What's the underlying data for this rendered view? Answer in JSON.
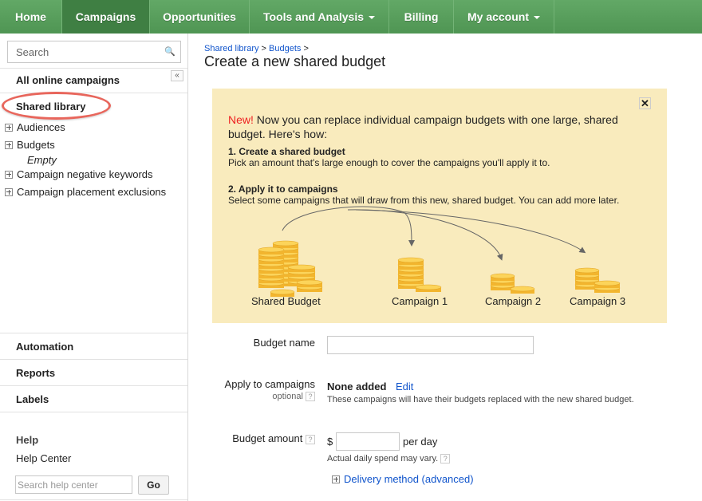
{
  "nav": {
    "tabs": [
      {
        "label": "Home"
      },
      {
        "label": "Campaigns"
      },
      {
        "label": "Opportunities"
      },
      {
        "label": "Tools and Analysis"
      },
      {
        "label": "Billing"
      },
      {
        "label": "My account"
      }
    ]
  },
  "sidebar": {
    "search_placeholder": "Search",
    "all_campaigns": "All online campaigns",
    "collapse": "«",
    "shared_library": "Shared library",
    "tree": [
      {
        "label": "Audiences"
      },
      {
        "label": "Budgets"
      },
      {
        "label": "Campaign negative keywords"
      },
      {
        "label": "Campaign placement exclusions"
      }
    ],
    "budgets_empty": "Empty",
    "automation": "Automation",
    "reports": "Reports",
    "labels": "Labels",
    "help": "Help",
    "help_center": "Help Center",
    "help_search_placeholder": "Search help center",
    "go": "Go"
  },
  "breadcrumb": {
    "shared_library": "Shared library",
    "budgets": "Budgets",
    "sep": ">"
  },
  "page_title": "Create a new shared budget",
  "promo": {
    "new": "New!",
    "intro": "Now you can replace individual campaign budgets with one large, shared budget. Here's how:",
    "close": "✕",
    "step1_title": "1. Create a shared budget",
    "step1_text": "Pick an amount that's large enough to cover the campaigns you'll apply it to.",
    "step2_title": "2. Apply it to campaigns",
    "step2_text": "Select some campaigns that will draw from this new, shared budget. You can add more later.",
    "labels": [
      "Shared Budget",
      "Campaign 1",
      "Campaign 2",
      "Campaign 3"
    ]
  },
  "form": {
    "budget_name_label": "Budget name",
    "budget_name_value": "",
    "apply_label": "Apply to campaigns",
    "optional": "optional",
    "none_added": "None added",
    "edit": "Edit",
    "apply_help": "These campaigns will have their budgets replaced with the new shared budget.",
    "amount_label": "Budget amount",
    "currency": "$",
    "amount_value": "",
    "per_day": "per day",
    "spend_note": "Actual daily spend may vary.",
    "help_q": "?",
    "delivery": "Delivery method (advanced)"
  },
  "colors": {
    "nav": "#4f9553",
    "promo_bg": "#f9ebbd",
    "link": "#1155cc",
    "new": "#ee2222",
    "highlight": "#e8665c"
  }
}
